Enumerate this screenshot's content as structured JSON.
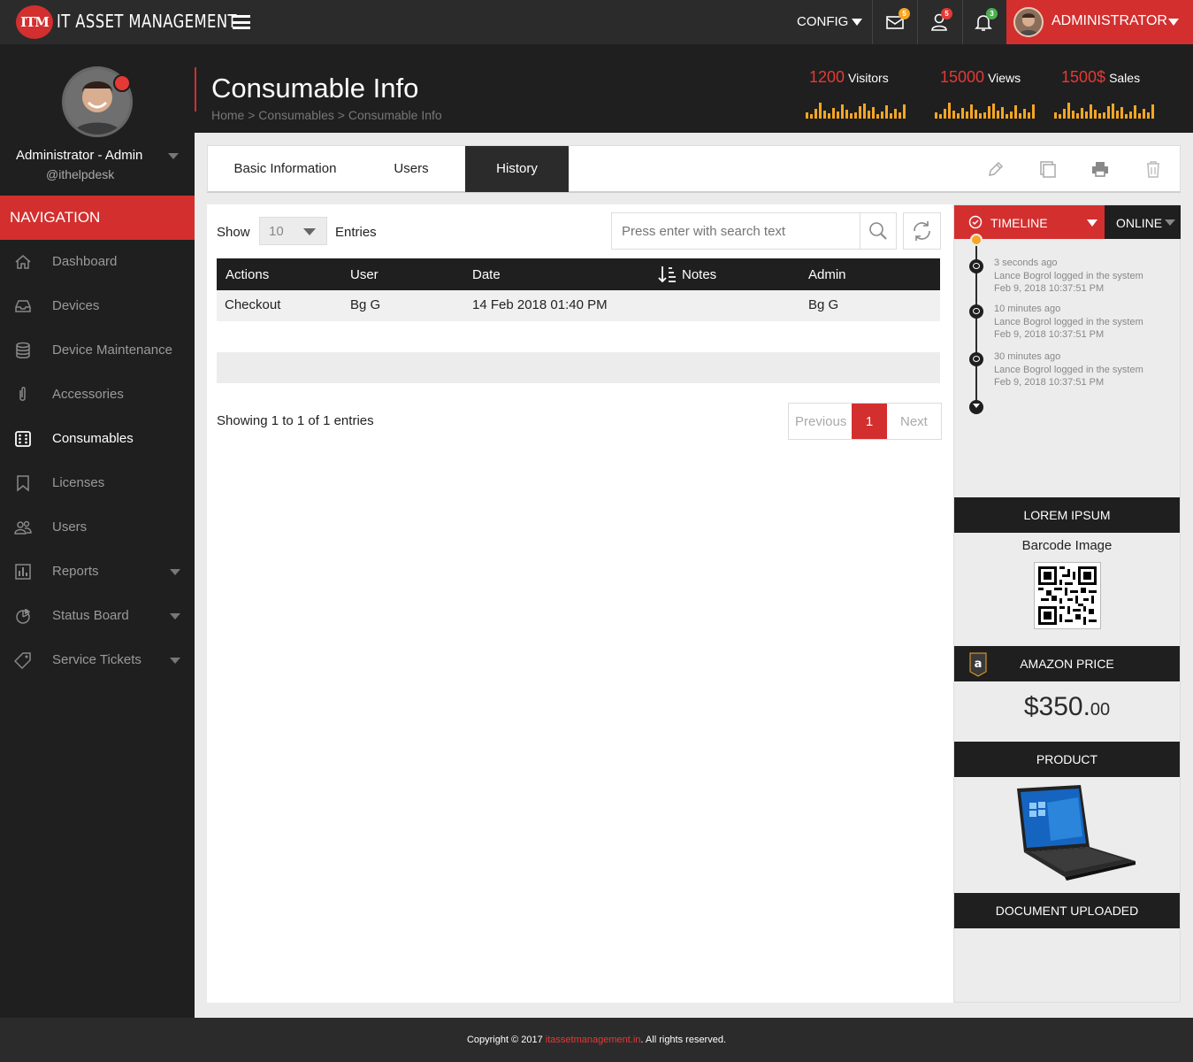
{
  "app": {
    "logo_badge": "ITM",
    "logo_text": "IT ASSET MANAGEMENT",
    "config_label": "CONFIG",
    "badges": {
      "mail": "5",
      "users": "5",
      "notifications": "3"
    },
    "admin_label": "ADMINISTRATOR",
    "colors": {
      "accent": "#d32f2f",
      "dark": "#1f1f1f",
      "spark": "#f5a623"
    }
  },
  "sidebar": {
    "profile_name": "Administrator - Admin",
    "profile_handle": "@ithelpdesk",
    "nav_header": "NAVIGATION",
    "items": [
      {
        "label": "Dashboard",
        "icon": "home-icon"
      },
      {
        "label": "Devices",
        "icon": "inbox-icon"
      },
      {
        "label": "Device Maintenance",
        "icon": "database-icon"
      },
      {
        "label": "Accessories",
        "icon": "paperclip-icon"
      },
      {
        "label": "Consumables",
        "icon": "dice-icon",
        "active": true
      },
      {
        "label": "Licenses",
        "icon": "bookmark-icon"
      },
      {
        "label": "Users",
        "icon": "users-icon"
      },
      {
        "label": "Reports",
        "icon": "bar-chart-icon",
        "has_submenu": true
      },
      {
        "label": "Status Board",
        "icon": "pie-chart-icon",
        "has_submenu": true
      },
      {
        "label": "Service Tickets",
        "icon": "tag-icon",
        "has_submenu": true
      }
    ]
  },
  "header": {
    "title": "Consumable Info",
    "breadcrumb": "Home > Consumables > Consumable Info",
    "stats": [
      {
        "value": "1200",
        "label": "Visitors"
      },
      {
        "value": "15000",
        "label": "Views"
      },
      {
        "value": "1500$",
        "label": "Sales"
      }
    ]
  },
  "tabs": [
    {
      "label": "Basic Information"
    },
    {
      "label": "Users"
    },
    {
      "label": "History",
      "active": true
    }
  ],
  "table": {
    "show_label": "Show",
    "page_size": "10",
    "entries_label": "Entries",
    "search_placeholder": "Press enter with search text",
    "columns": [
      "Actions",
      "User",
      "Date",
      "Notes",
      "Admin"
    ],
    "rows": [
      {
        "action": "Checkout",
        "user": "Bg G",
        "date": "14 Feb 2018 01:40 PM",
        "notes": "",
        "admin": "Bg G"
      }
    ],
    "showing": "Showing 1 to 1 of 1 entries",
    "pager": {
      "prev": "Previous",
      "current": "1",
      "next": "Next"
    }
  },
  "timeline": {
    "header": "TIMELINE",
    "status": "ONLINE",
    "entries": [
      {
        "ago": "3 seconds ago",
        "text": "Lance Bogrol logged in the system",
        "date": "Feb 9, 2018 10:37:51 PM"
      },
      {
        "ago": "10 minutes ago",
        "text": "Lance Bogrol logged in the system",
        "date": "Feb 9, 2018 10:37:51 PM"
      },
      {
        "ago": "30 minutes ago",
        "text": "Lance Bogrol logged in the system",
        "date": "Feb 9, 2018 10:37:51 PM"
      }
    ]
  },
  "widgets": {
    "lorem_header": "LOREM IPSUM",
    "barcode_label": "Barcode Image",
    "amazon_header": "AMAZON PRICE",
    "price_main": "$350.",
    "price_cents": "00",
    "product_header": "PRODUCT",
    "document_header": "DOCUMENT UPLOADED"
  },
  "footer": {
    "prefix": "Copyright © 2017 ",
    "link": "itassetmanagement.in",
    "suffix": ". All rights reserved."
  }
}
